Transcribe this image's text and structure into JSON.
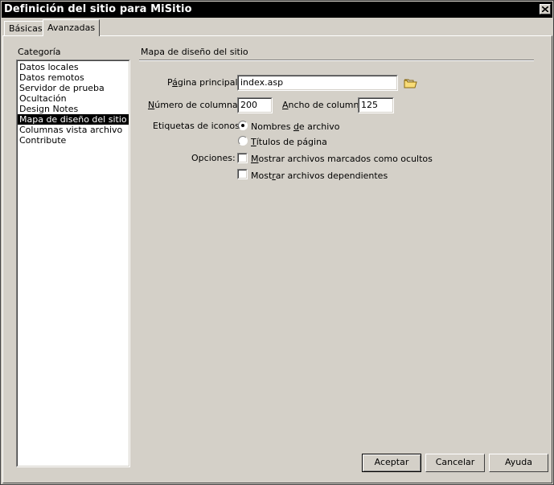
{
  "window": {
    "title": "Definición del sitio para MiSitio",
    "close_glyph": "close-icon"
  },
  "tabs": [
    {
      "label": "Básicas"
    },
    {
      "label": "Avanzadas"
    }
  ],
  "category": {
    "label": "Categoría",
    "items": [
      {
        "label": "Datos locales"
      },
      {
        "label": "Datos remotos"
      },
      {
        "label": "Servidor de prueba"
      },
      {
        "label": "Ocultación"
      },
      {
        "label": "Design Notes"
      },
      {
        "label": "Mapa de diseño del sitio"
      },
      {
        "label": "Columnas vista archivo"
      },
      {
        "label": "Contribute"
      }
    ],
    "selected_index": 5
  },
  "section": {
    "title": "Mapa de diseño del sitio"
  },
  "form": {
    "home_page": {
      "prefix": "P",
      "underline": "á",
      "suffix": "gina principal:",
      "value": "index.asp"
    },
    "columns": {
      "underline": "N",
      "suffix": "úmero de columnas:",
      "value": "200"
    },
    "col_width": {
      "underline": "A",
      "suffix": "ncho de columna:",
      "value": "125"
    },
    "icon_labels": {
      "label": "Etiquetas de iconos:",
      "opt1": {
        "prefix": "Nombres ",
        "underline": "d",
        "suffix": "e archivo",
        "checked": true
      },
      "opt2": {
        "underline": "T",
        "suffix": "ítulos de página",
        "checked": false
      }
    },
    "options": {
      "label": "Opciones:",
      "opt1": {
        "underline": "M",
        "suffix": "ostrar archivos marcados como ocultos",
        "checked": false
      },
      "opt2": {
        "prefix": "Most",
        "underline": "r",
        "suffix": "ar archivos dependientes",
        "checked": false
      }
    }
  },
  "buttons": {
    "ok": "Aceptar",
    "cancel": "Cancelar",
    "help": "Ayuda"
  },
  "colors": {
    "face": "#d4d0c8",
    "titlebar": "#000000",
    "selection": "#000000",
    "folder_icon": "#f0c040"
  }
}
